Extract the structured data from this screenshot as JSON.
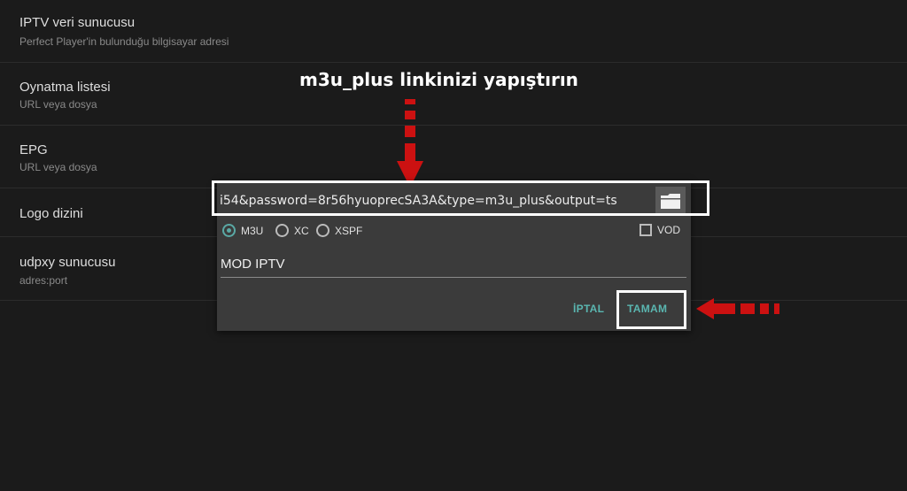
{
  "settings": {
    "items": [
      {
        "title": "IPTV veri sunucusu",
        "subtitle": "Perfect Player'in bulunduğu bilgisayar adresi"
      },
      {
        "title": "Oynatma listesi",
        "subtitle": "URL veya dosya"
      },
      {
        "title": "EPG",
        "subtitle": "URL veya dosya"
      },
      {
        "title": "Logo dizini",
        "subtitle": ""
      },
      {
        "title": "udpxy sunucusu",
        "subtitle": "adres:port"
      }
    ]
  },
  "dialog": {
    "url_value": "i54&password=8r56hyuoprecSA3A&type=m3u_plus&output=ts",
    "format_options": [
      {
        "label": "M3U",
        "selected": true
      },
      {
        "label": "XC",
        "selected": false
      },
      {
        "label": "XSPF",
        "selected": false
      }
    ],
    "vod_label": "VOD",
    "vod_checked": false,
    "name_value": "MOD IPTV",
    "cancel_label": "İPTAL",
    "ok_label": "TAMAM"
  },
  "annotation": {
    "text": "m3u_plus linkinizi yapıştırın"
  },
  "colors": {
    "accent": "#5ab6b0",
    "arrow": "#cc1111",
    "background": "#1b1b1b",
    "dialog": "#3b3b3b"
  }
}
